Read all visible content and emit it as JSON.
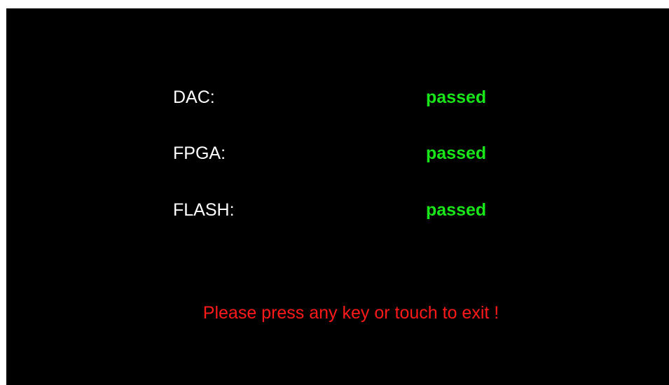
{
  "tests": [
    {
      "label": "DAC:",
      "status": "passed"
    },
    {
      "label": "FPGA:",
      "status": "passed"
    },
    {
      "label": "FLASH:",
      "status": "passed"
    }
  ],
  "exit_message": "Please press any key or touch to exit !",
  "colors": {
    "background": "#000000",
    "label": "#ffffff",
    "status_passed": "#19e619",
    "exit_message": "#ff1a1a"
  }
}
